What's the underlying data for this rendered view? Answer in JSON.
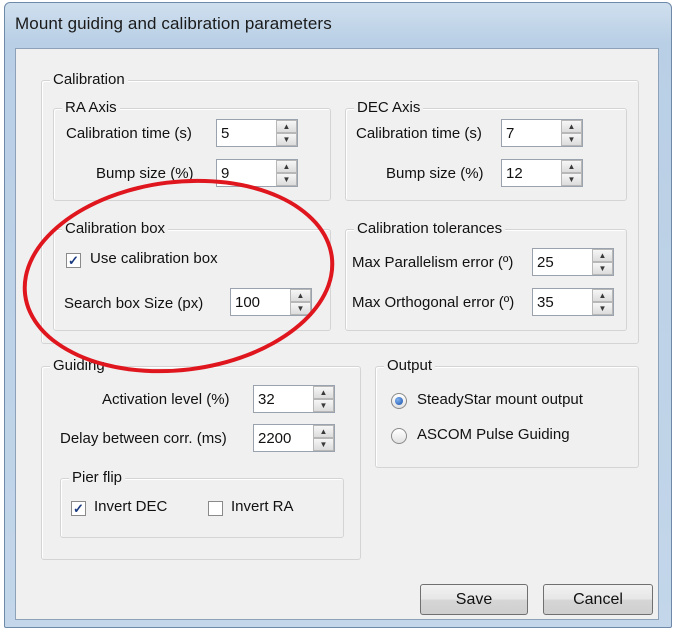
{
  "window": {
    "title": "Mount guiding and calibration parameters"
  },
  "calibration": {
    "legend": "Calibration",
    "ra_axis": {
      "legend": "RA Axis",
      "calibration_time_label": "Calibration time (s)",
      "calibration_time_value": "5",
      "bump_size_label": "Bump size (%)",
      "bump_size_value": "9"
    },
    "dec_axis": {
      "legend": "DEC Axis",
      "calibration_time_label": "Calibration time (s)",
      "calibration_time_value": "7",
      "bump_size_label": "Bump size (%)",
      "bump_size_value": "12"
    },
    "calibration_box": {
      "legend": "Calibration box",
      "use_label": "Use calibration box",
      "use_checked": true,
      "search_size_label": "Search box Size (px)",
      "search_size_value": "100"
    },
    "tolerances": {
      "legend": "Calibration tolerances",
      "parallelism_label": "Max Parallelism error (º)",
      "parallelism_value": "25",
      "orthogonal_label": "Max Orthogonal error (º)",
      "orthogonal_value": "35"
    }
  },
  "guiding": {
    "legend": "Guiding",
    "activation_label": "Activation level (%)",
    "activation_value": "32",
    "delay_label": "Delay between corr. (ms)",
    "delay_value": "2200",
    "pier_flip": {
      "legend": "Pier flip",
      "invert_dec_label": "Invert DEC",
      "invert_dec_checked": true,
      "invert_ra_label": "Invert RA",
      "invert_ra_checked": false
    }
  },
  "output": {
    "legend": "Output",
    "options": [
      {
        "label": "SteadyStar mount output",
        "selected": true
      },
      {
        "label": "ASCOM Pulse Guiding",
        "selected": false
      }
    ]
  },
  "buttons": {
    "save": "Save",
    "cancel": "Cancel"
  },
  "annotation": {
    "color": "#e0161e"
  },
  "icons": {
    "spin_up": "triangle-up",
    "spin_down": "triangle-down",
    "check": "checkmark"
  }
}
